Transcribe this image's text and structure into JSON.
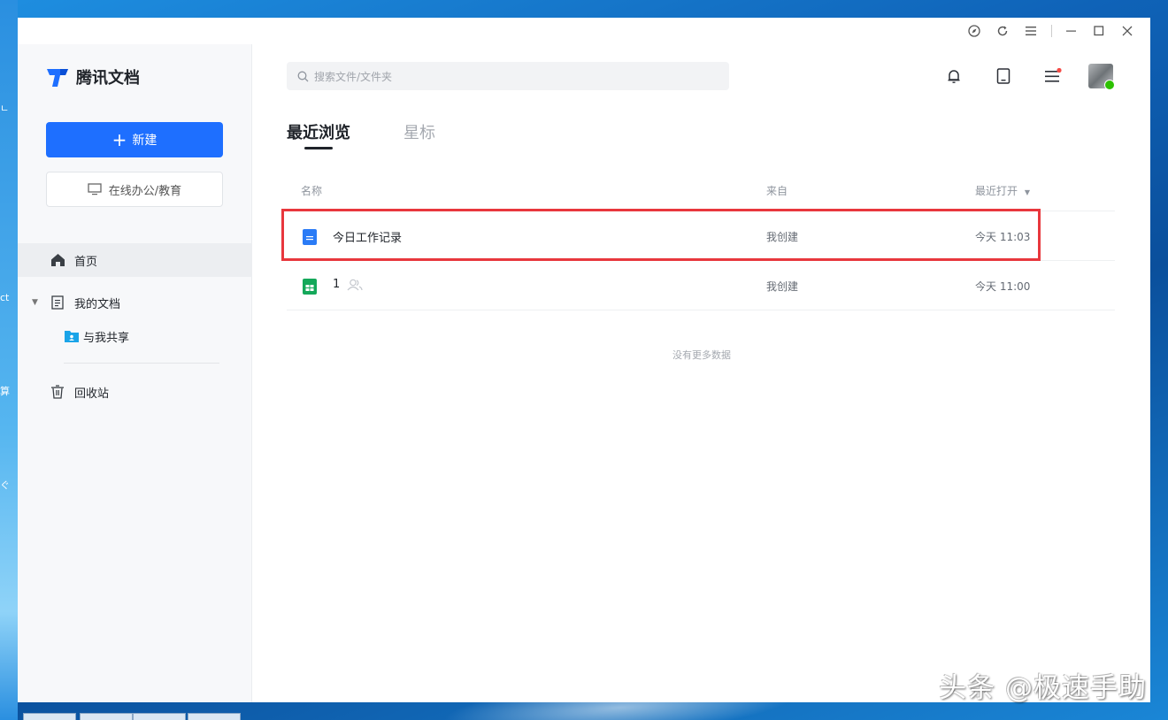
{
  "app": {
    "name": "腾讯文档",
    "brand_color": "#1e6fff"
  },
  "sidebar": {
    "new_button": "新建",
    "online_button": "在线办公/教育",
    "nav": [
      {
        "label": "首页",
        "icon": "home-icon",
        "active": true
      },
      {
        "label": "我的文档",
        "icon": "document-icon",
        "expanded": true
      },
      {
        "label": "与我共享",
        "icon": "shared-folder-icon"
      },
      {
        "label": "回收站",
        "icon": "trash-icon"
      }
    ]
  },
  "header": {
    "search_placeholder": "搜索文件/文件夹",
    "icons": [
      "bell-icon",
      "tablet-icon",
      "menu-icon"
    ],
    "menu_badge_color": "#f54a45"
  },
  "tabs": [
    {
      "label": "最近浏览",
      "active": true
    },
    {
      "label": "星标",
      "active": false
    }
  ],
  "table": {
    "columns": [
      "名称",
      "来自",
      "最近打开"
    ],
    "rows": [
      {
        "name": "今日工作记录",
        "type": "doc",
        "from": "我创建",
        "opened": "今天 11:03",
        "highlighted": true
      },
      {
        "name": "1",
        "type": "sheet",
        "from": "我创建",
        "opened": "今天 11:00",
        "shared": true
      }
    ],
    "empty_tip": "没有更多数据"
  },
  "highlight_color": "#e8373d",
  "watermark": "头条 @极速手助"
}
